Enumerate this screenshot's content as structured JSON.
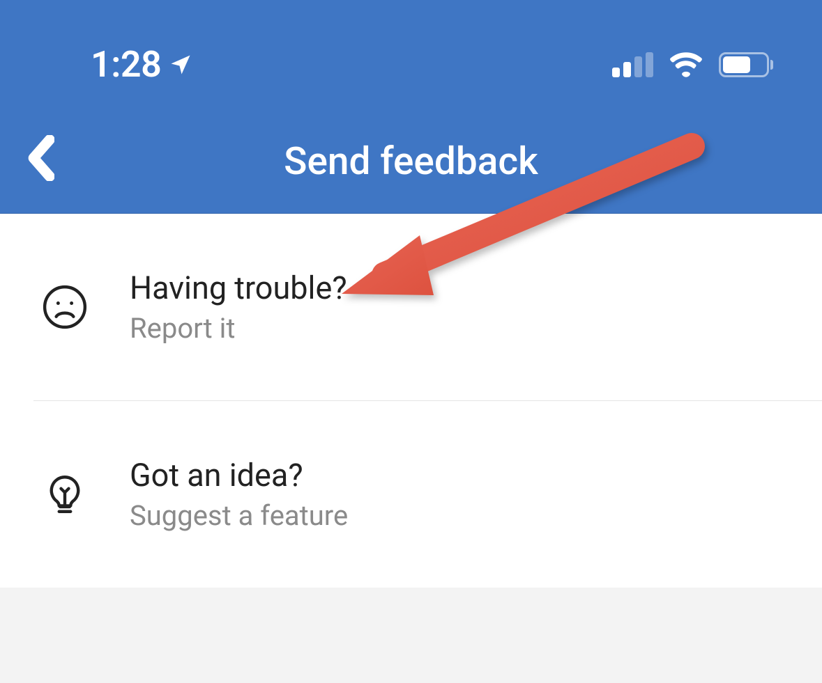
{
  "status_bar": {
    "time": "1:28"
  },
  "header": {
    "title": "Send feedback"
  },
  "options": [
    {
      "title": "Having trouble?",
      "subtitle": "Report it"
    },
    {
      "title": "Got an idea?",
      "subtitle": "Suggest a feature"
    }
  ]
}
